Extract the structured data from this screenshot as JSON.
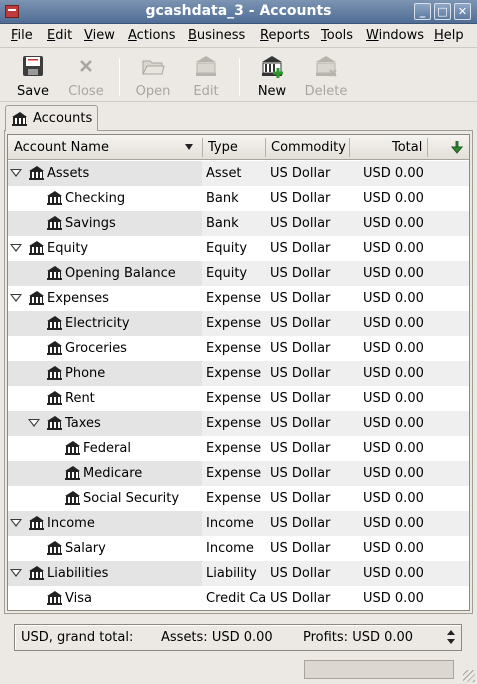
{
  "window": {
    "title": "gcashdata_3 - Accounts",
    "buttons": [
      "_",
      "□",
      "✕"
    ]
  },
  "menubar": [
    {
      "label": "File",
      "u": "F",
      "rest": "ile"
    },
    {
      "label": "Edit",
      "u": "E",
      "rest": "dit"
    },
    {
      "label": "View",
      "u": "V",
      "rest": "iew"
    },
    {
      "label": "Actions",
      "u": "A",
      "rest": "ctions"
    },
    {
      "label": "Business",
      "u": "B",
      "rest": "usiness"
    },
    {
      "label": "Reports",
      "u": "R",
      "rest": "eports"
    },
    {
      "label": "Tools",
      "u": "T",
      "rest": "ools"
    },
    {
      "label": "Windows",
      "u": "W",
      "rest": "indows"
    },
    {
      "label": "Help",
      "u": "H",
      "rest": "elp"
    }
  ],
  "toolbar": {
    "save": "Save",
    "close": "Close",
    "open": "Open",
    "edit": "Edit",
    "new": "New",
    "delete": "Delete"
  },
  "tab": {
    "label": "Accounts"
  },
  "columns": {
    "name": "Account Name",
    "type": "Type",
    "commodity": "Commodity",
    "total": "Total"
  },
  "accounts": [
    {
      "name": "Assets",
      "type": "Asset",
      "commodity": "US Dollar",
      "total": "USD 0.00",
      "depth": 0,
      "expander": true
    },
    {
      "name": "Checking",
      "type": "Bank",
      "commodity": "US Dollar",
      "total": "USD 0.00",
      "depth": 1,
      "expander": false
    },
    {
      "name": "Savings",
      "type": "Bank",
      "commodity": "US Dollar",
      "total": "USD 0.00",
      "depth": 1,
      "expander": false
    },
    {
      "name": "Equity",
      "type": "Equity",
      "commodity": "US Dollar",
      "total": "USD 0.00",
      "depth": 0,
      "expander": true
    },
    {
      "name": "Opening Balance",
      "type": "Equity",
      "commodity": "US Dollar",
      "total": "USD 0.00",
      "depth": 1,
      "expander": false
    },
    {
      "name": "Expenses",
      "type": "Expense",
      "commodity": "US Dollar",
      "total": "USD 0.00",
      "depth": 0,
      "expander": true
    },
    {
      "name": "Electricity",
      "type": "Expense",
      "commodity": "US Dollar",
      "total": "USD 0.00",
      "depth": 1,
      "expander": false
    },
    {
      "name": "Groceries",
      "type": "Expense",
      "commodity": "US Dollar",
      "total": "USD 0.00",
      "depth": 1,
      "expander": false
    },
    {
      "name": "Phone",
      "type": "Expense",
      "commodity": "US Dollar",
      "total": "USD 0.00",
      "depth": 1,
      "expander": false
    },
    {
      "name": "Rent",
      "type": "Expense",
      "commodity": "US Dollar",
      "total": "USD 0.00",
      "depth": 1,
      "expander": false
    },
    {
      "name": "Taxes",
      "type": "Expense",
      "commodity": "US Dollar",
      "total": "USD 0.00",
      "depth": 1,
      "expander": true
    },
    {
      "name": "Federal",
      "type": "Expense",
      "commodity": "US Dollar",
      "total": "USD 0.00",
      "depth": 2,
      "expander": false
    },
    {
      "name": "Medicare",
      "type": "Expense",
      "commodity": "US Dollar",
      "total": "USD 0.00",
      "depth": 2,
      "expander": false
    },
    {
      "name": "Social Security",
      "type": "Expense",
      "commodity": "US Dollar",
      "total": "USD 0.00",
      "depth": 2,
      "expander": false
    },
    {
      "name": "Income",
      "type": "Income",
      "commodity": "US Dollar",
      "total": "USD 0.00",
      "depth": 0,
      "expander": true
    },
    {
      "name": "Salary",
      "type": "Income",
      "commodity": "US Dollar",
      "total": "USD 0.00",
      "depth": 1,
      "expander": false
    },
    {
      "name": "Liabilities",
      "type": "Liability",
      "commodity": "US Dollar",
      "total": "USD 0.00",
      "depth": 0,
      "expander": true
    },
    {
      "name": "Visa",
      "type": "Credit Ca",
      "commodity": "US Dollar",
      "total": "USD 0.00",
      "depth": 1,
      "expander": false
    }
  ],
  "summary": {
    "label": "USD, grand total:",
    "assets": "Assets: USD 0.00",
    "profits": "Profits: USD 0.00"
  },
  "colors": {
    "titlebar": "#4f6d95",
    "window_bg": "#ece9e4",
    "alt_row": "#efefef",
    "new_plus": "#2e9a2e"
  }
}
